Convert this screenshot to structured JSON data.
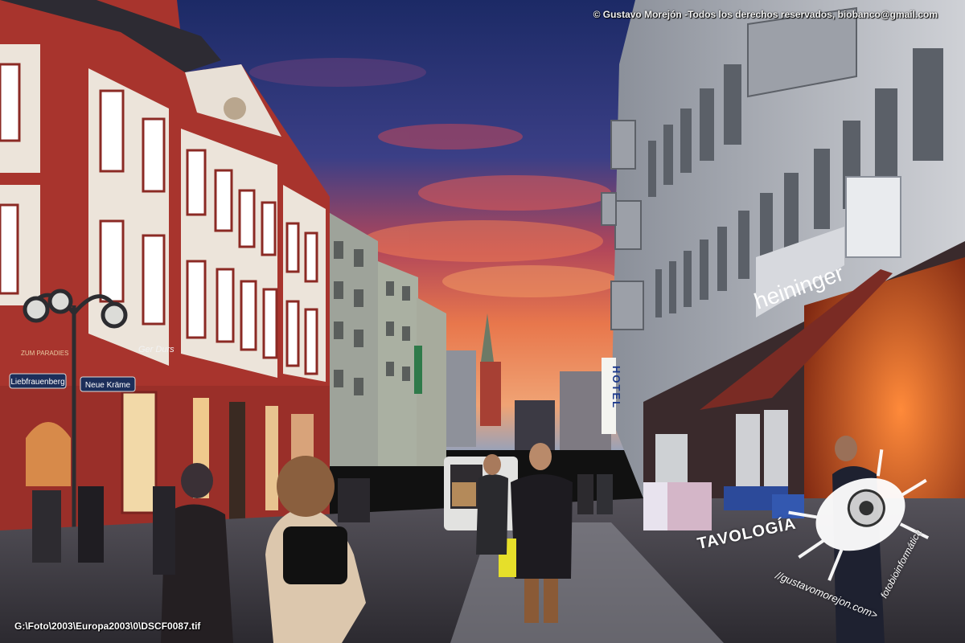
{
  "photo": {
    "copyright": "© Gustavo Morejón -Todos los derechos reservados, biobanco@gmail.com",
    "file_path": "G:\\Foto\\2003\\Europa2003\\0\\DSCF0087.tif"
  },
  "signs": {
    "store_name": "heininger",
    "hotel": "HOTEL",
    "street_sign_1": "Liebfrauenberg",
    "street_sign_2": "Neue Kräme",
    "building_sign": "ZUM PARADIES",
    "shop_sign_left": "Ger Durs"
  },
  "watermark": {
    "brand": "TAVOLOGÍA",
    "url": "//gustavomorejon.com>",
    "url2": "fotobioinformática",
    "icon": "bug-icon"
  },
  "colors": {
    "sky_top": "#1b2a6b",
    "sky_sunset": "#e8734a",
    "building_red": "#a8322c",
    "building_right": "#c7c9cf",
    "awning_red": "#7a2b24"
  }
}
